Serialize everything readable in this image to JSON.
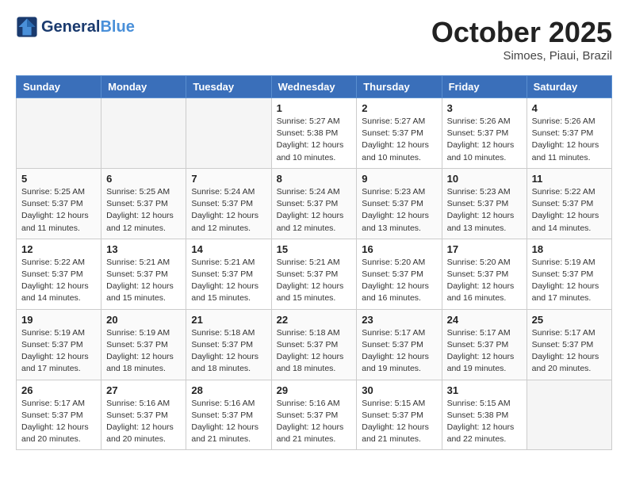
{
  "header": {
    "logo_line1": "General",
    "logo_line2": "Blue",
    "month": "October 2025",
    "location": "Simoes, Piaui, Brazil"
  },
  "weekdays": [
    "Sunday",
    "Monday",
    "Tuesday",
    "Wednesday",
    "Thursday",
    "Friday",
    "Saturday"
  ],
  "weeks": [
    [
      {
        "day": "",
        "info": ""
      },
      {
        "day": "",
        "info": ""
      },
      {
        "day": "",
        "info": ""
      },
      {
        "day": "1",
        "info": "Sunrise: 5:27 AM\nSunset: 5:38 PM\nDaylight: 12 hours\nand 10 minutes."
      },
      {
        "day": "2",
        "info": "Sunrise: 5:27 AM\nSunset: 5:37 PM\nDaylight: 12 hours\nand 10 minutes."
      },
      {
        "day": "3",
        "info": "Sunrise: 5:26 AM\nSunset: 5:37 PM\nDaylight: 12 hours\nand 10 minutes."
      },
      {
        "day": "4",
        "info": "Sunrise: 5:26 AM\nSunset: 5:37 PM\nDaylight: 12 hours\nand 11 minutes."
      }
    ],
    [
      {
        "day": "5",
        "info": "Sunrise: 5:25 AM\nSunset: 5:37 PM\nDaylight: 12 hours\nand 11 minutes."
      },
      {
        "day": "6",
        "info": "Sunrise: 5:25 AM\nSunset: 5:37 PM\nDaylight: 12 hours\nand 12 minutes."
      },
      {
        "day": "7",
        "info": "Sunrise: 5:24 AM\nSunset: 5:37 PM\nDaylight: 12 hours\nand 12 minutes."
      },
      {
        "day": "8",
        "info": "Sunrise: 5:24 AM\nSunset: 5:37 PM\nDaylight: 12 hours\nand 12 minutes."
      },
      {
        "day": "9",
        "info": "Sunrise: 5:23 AM\nSunset: 5:37 PM\nDaylight: 12 hours\nand 13 minutes."
      },
      {
        "day": "10",
        "info": "Sunrise: 5:23 AM\nSunset: 5:37 PM\nDaylight: 12 hours\nand 13 minutes."
      },
      {
        "day": "11",
        "info": "Sunrise: 5:22 AM\nSunset: 5:37 PM\nDaylight: 12 hours\nand 14 minutes."
      }
    ],
    [
      {
        "day": "12",
        "info": "Sunrise: 5:22 AM\nSunset: 5:37 PM\nDaylight: 12 hours\nand 14 minutes."
      },
      {
        "day": "13",
        "info": "Sunrise: 5:21 AM\nSunset: 5:37 PM\nDaylight: 12 hours\nand 15 minutes."
      },
      {
        "day": "14",
        "info": "Sunrise: 5:21 AM\nSunset: 5:37 PM\nDaylight: 12 hours\nand 15 minutes."
      },
      {
        "day": "15",
        "info": "Sunrise: 5:21 AM\nSunset: 5:37 PM\nDaylight: 12 hours\nand 15 minutes."
      },
      {
        "day": "16",
        "info": "Sunrise: 5:20 AM\nSunset: 5:37 PM\nDaylight: 12 hours\nand 16 minutes."
      },
      {
        "day": "17",
        "info": "Sunrise: 5:20 AM\nSunset: 5:37 PM\nDaylight: 12 hours\nand 16 minutes."
      },
      {
        "day": "18",
        "info": "Sunrise: 5:19 AM\nSunset: 5:37 PM\nDaylight: 12 hours\nand 17 minutes."
      }
    ],
    [
      {
        "day": "19",
        "info": "Sunrise: 5:19 AM\nSunset: 5:37 PM\nDaylight: 12 hours\nand 17 minutes."
      },
      {
        "day": "20",
        "info": "Sunrise: 5:19 AM\nSunset: 5:37 PM\nDaylight: 12 hours\nand 18 minutes."
      },
      {
        "day": "21",
        "info": "Sunrise: 5:18 AM\nSunset: 5:37 PM\nDaylight: 12 hours\nand 18 minutes."
      },
      {
        "day": "22",
        "info": "Sunrise: 5:18 AM\nSunset: 5:37 PM\nDaylight: 12 hours\nand 18 minutes."
      },
      {
        "day": "23",
        "info": "Sunrise: 5:17 AM\nSunset: 5:37 PM\nDaylight: 12 hours\nand 19 minutes."
      },
      {
        "day": "24",
        "info": "Sunrise: 5:17 AM\nSunset: 5:37 PM\nDaylight: 12 hours\nand 19 minutes."
      },
      {
        "day": "25",
        "info": "Sunrise: 5:17 AM\nSunset: 5:37 PM\nDaylight: 12 hours\nand 20 minutes."
      }
    ],
    [
      {
        "day": "26",
        "info": "Sunrise: 5:17 AM\nSunset: 5:37 PM\nDaylight: 12 hours\nand 20 minutes."
      },
      {
        "day": "27",
        "info": "Sunrise: 5:16 AM\nSunset: 5:37 PM\nDaylight: 12 hours\nand 20 minutes."
      },
      {
        "day": "28",
        "info": "Sunrise: 5:16 AM\nSunset: 5:37 PM\nDaylight: 12 hours\nand 21 minutes."
      },
      {
        "day": "29",
        "info": "Sunrise: 5:16 AM\nSunset: 5:37 PM\nDaylight: 12 hours\nand 21 minutes."
      },
      {
        "day": "30",
        "info": "Sunrise: 5:15 AM\nSunset: 5:37 PM\nDaylight: 12 hours\nand 21 minutes."
      },
      {
        "day": "31",
        "info": "Sunrise: 5:15 AM\nSunset: 5:38 PM\nDaylight: 12 hours\nand 22 minutes."
      },
      {
        "day": "",
        "info": ""
      }
    ]
  ]
}
